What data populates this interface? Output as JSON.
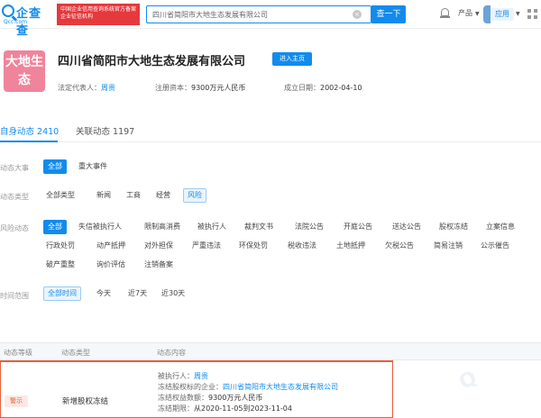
{
  "header": {
    "logo_text": "企查查",
    "logo_domain": "Qcc.com",
    "badge_text": "中国企业信用查询系统官方备案企业征信机构",
    "search_value": "四川省简阳市大地生态发展有限公司",
    "search_button": "查一下",
    "products_label": "产品",
    "use_label": "应用"
  },
  "company": {
    "logo_text": "大地生态",
    "name": "四川省简阳市大地生态发展有限公司",
    "enter_button": "进入主页",
    "legal_rep_label": "法定代表人：",
    "legal_rep": "周贵",
    "capital_label": "注册资本：",
    "capital": "9300万元人民币",
    "founded_label": "成立日期：",
    "founded": "2002-04-10"
  },
  "tabs": [
    {
      "label": "自身动态 2410",
      "active": true
    },
    {
      "label": "关联动态 1197",
      "active": false
    }
  ],
  "filters": {
    "major": {
      "label": "动态大事",
      "options": [
        "全部",
        "重大事件"
      ]
    },
    "category": {
      "label": "动态类型",
      "options": [
        "全部类型",
        "新闻",
        "工商",
        "经营",
        "风险"
      ]
    },
    "risk": {
      "label": "风险动态",
      "row1": [
        "全部",
        "失信被执行人",
        "限制高消费",
        "被执行人",
        "裁判文书",
        "法院公告",
        "开庭公告",
        "送达公告",
        "股权冻结",
        "立案信息"
      ],
      "row2": [
        "行政处罚",
        "动产抵押",
        "对外担保",
        "严重违法",
        "环保处罚",
        "税收违法",
        "土地抵押",
        "欠税公告",
        "简易注销",
        "公示催告"
      ],
      "row3": [
        "破产重整",
        "询价评估",
        "注销备案"
      ]
    },
    "time": {
      "label": "时间范围",
      "options": [
        "全部时间",
        "今天",
        "近7天",
        "近30天"
      ]
    }
  },
  "table": {
    "headers": [
      "动态等级",
      "动态类型",
      "动态内容"
    ],
    "rows": [
      {
        "level": "警示",
        "type": "新增股权冻结",
        "executed_label": "被执行人：",
        "executed": "周贵",
        "company_label": "冻结股权标的企业：",
        "company": "四川省简阳市大地生态发展有限公司",
        "amount_label": "冻结权益数额：",
        "amount": "9300万元人民币",
        "period_label": "冻结期限：",
        "period": "从2020-11-05到2023-11-04"
      }
    ]
  },
  "colors": {
    "accent": "#128bed",
    "danger": "#e65f3a",
    "logo_bg": "#f0849a"
  }
}
